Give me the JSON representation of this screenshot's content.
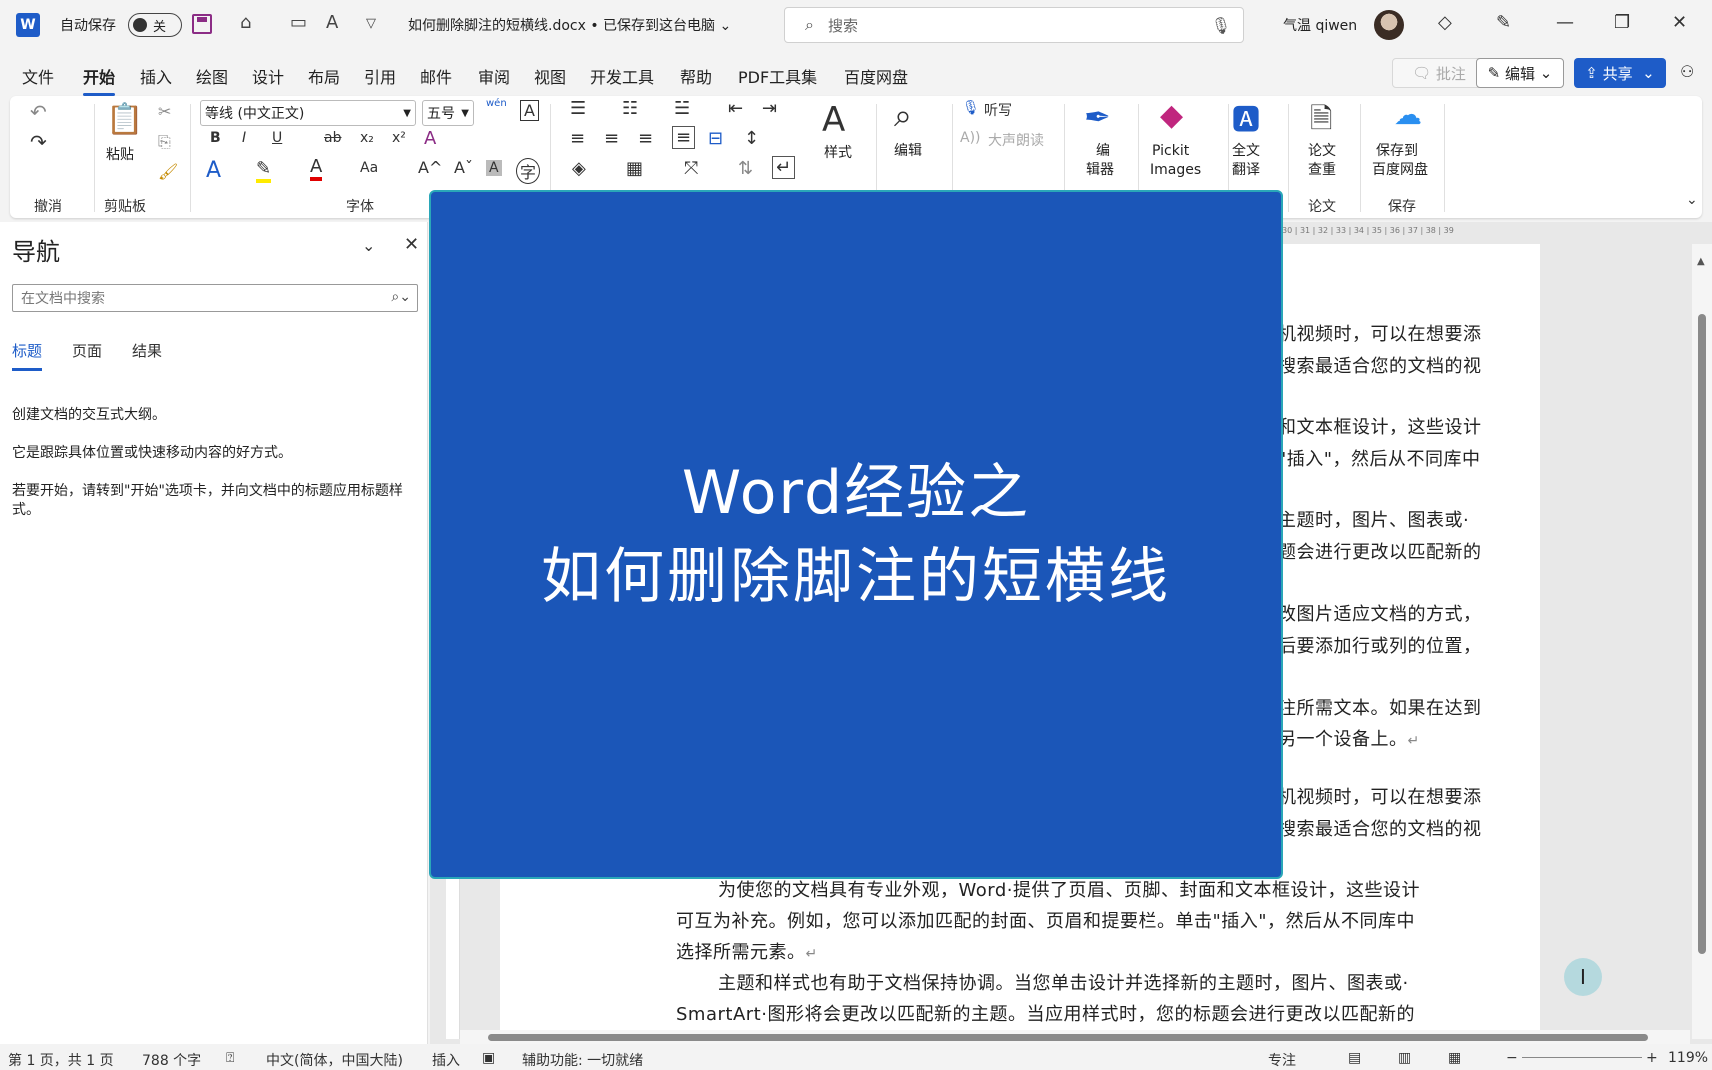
{
  "titlebar": {
    "app_letter": "W",
    "autosave_label": "自动保存",
    "autosave_state": "关",
    "doc_title": "如何删除脚注的短横线.docx • 已保存到这台电脑 ⌄",
    "search_placeholder": "搜索",
    "user_name": "气温 qiwen"
  },
  "menu": {
    "tabs": [
      "文件",
      "开始",
      "插入",
      "绘图",
      "设计",
      "布局",
      "引用",
      "邮件",
      "审阅",
      "视图",
      "开发工具",
      "帮助",
      "PDF工具集",
      "百度网盘"
    ],
    "active": "开始",
    "comment_label": "批注",
    "edit_label": "编辑",
    "share_label": "共享"
  },
  "ribbon": {
    "undo_group": "撤消",
    "clipboard_group": "剪贴板",
    "paste_label": "粘贴",
    "font_group": "字体",
    "font_name": "等线 (中文正文)",
    "font_size": "五号",
    "styles_label": "样式",
    "edit_label": "编辑",
    "dictate_label": "听写",
    "read_aloud_label": "大声朗读",
    "editor_label_1": "编",
    "editor_label_2": "辑器",
    "pickit_label_1": "Pickit",
    "pickit_label_2": "Images",
    "translate_label_1": "全文",
    "translate_label_2": "翻译",
    "paper_label_1": "论文",
    "paper_label_2": "查重",
    "paper_group": "论文",
    "baidu_label_1": "保存到",
    "baidu_label_2": "百度网盘",
    "save_group": "保存"
  },
  "nav": {
    "title": "导航",
    "search_placeholder": "在文档中搜索",
    "tabs": [
      "标题",
      "页面",
      "结果"
    ],
    "text1": "创建文档的交互式大纲。",
    "text2": "它是跟踪具体位置或快速移动内容的好方式。",
    "text3": "若要开始，请转到\"开始\"选项卡，并向文档中的标题应用标题样式。"
  },
  "ruler_text": "30 | 31 | 32 | 33 | 34 | 35 | 36 | 37 | 38 | 39",
  "doc": {
    "lines": [
      "机视频时，可以在想要添",
      "搜索最适合您的文档的视",
      "和文本框设计，这些设计",
      "\"插入\"，然后从不同库中",
      "主题时，图片、图表或·",
      "题会进行更改以匹配新的",
      "改图片适应文档的方式，",
      "后要添加行或列的位置，",
      "注所需文本。如果在达到",
      "另一个设备上。",
      "机视频时，可以在想要添",
      "搜索最适合您的文档的视",
      "为使您的文档具有专业外观，Word·提供了页眉、页脚、封面和文本框设计，这些设计",
      "可互为补充。例如，您可以添加匹配的封面、页眉和提要栏。单击\"插入\"，然后从不同库中",
      "选择所需元素。",
      "主题和样式也有助于文档保持协调。当您单击设计并选择新的主题时，图片、图表或·",
      "SmartArt·图形将会更改以匹配新的主题。当应用样式时，您的标题会进行更改以匹配新的"
    ]
  },
  "overlay": {
    "line1": "Word经验之",
    "line2": "如何删除脚注的短横线"
  },
  "status": {
    "page": "第 1 页，共 1 页",
    "words": "788 个字",
    "language": "中文(简体，中国大陆)",
    "insert": "插入",
    "accessibility": "辅助功能: 一切就绪",
    "focus": "专注",
    "zoom": "119%"
  }
}
